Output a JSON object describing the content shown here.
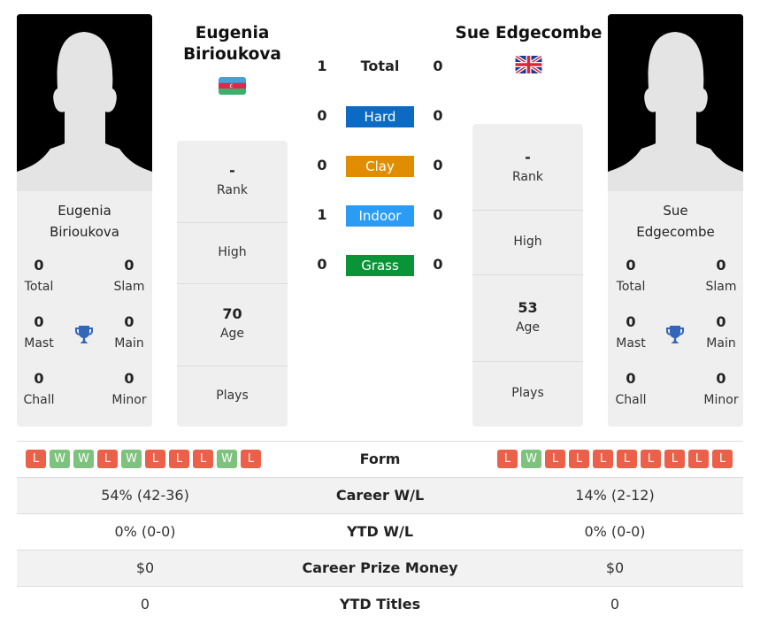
{
  "player1": {
    "name": "Eugenia Birioukova",
    "name_line1": "Eugenia",
    "name_line2": "Birioukova",
    "flag": "azerbaijan-flag",
    "titles": {
      "total": {
        "value": "0",
        "label": "Total"
      },
      "slam": {
        "value": "0",
        "label": "Slam"
      },
      "mast": {
        "value": "0",
        "label": "Mast"
      },
      "main": {
        "value": "0",
        "label": "Main"
      },
      "chall": {
        "value": "0",
        "label": "Chall"
      },
      "minor": {
        "value": "0",
        "label": "Minor"
      }
    },
    "info": {
      "rank": {
        "value": "-",
        "label": "Rank"
      },
      "high": {
        "value": "",
        "label": "High"
      },
      "age": {
        "value": "70",
        "label": "Age"
      },
      "plays": {
        "value": "",
        "label": "Plays"
      }
    },
    "form": [
      "L",
      "W",
      "W",
      "L",
      "W",
      "L",
      "L",
      "L",
      "W",
      "L"
    ],
    "career_wl": "54% (42-36)",
    "ytd_wl": "0% (0-0)",
    "prize_money": "$0",
    "ytd_titles": "0"
  },
  "player2": {
    "name": "Sue Edgecombe",
    "name_line1": "Sue",
    "name_line2": "Edgecombe",
    "flag": "united-kingdom-flag",
    "titles": {
      "total": {
        "value": "0",
        "label": "Total"
      },
      "slam": {
        "value": "0",
        "label": "Slam"
      },
      "mast": {
        "value": "0",
        "label": "Mast"
      },
      "main": {
        "value": "0",
        "label": "Main"
      },
      "chall": {
        "value": "0",
        "label": "Chall"
      },
      "minor": {
        "value": "0",
        "label": "Minor"
      }
    },
    "info": {
      "rank": {
        "value": "-",
        "label": "Rank"
      },
      "high": {
        "value": "",
        "label": "High"
      },
      "age": {
        "value": "53",
        "label": "Age"
      },
      "plays": {
        "value": "",
        "label": "Plays"
      }
    },
    "form": [
      "L",
      "W",
      "L",
      "L",
      "L",
      "L",
      "L",
      "L",
      "L",
      "L"
    ],
    "career_wl": "14% (2-12)",
    "ytd_wl": "0% (0-0)",
    "prize_money": "$0",
    "ytd_titles": "0"
  },
  "h2h": {
    "total": {
      "label": "Total",
      "p1": "1",
      "p2": "0"
    },
    "surfaces": [
      {
        "label": "Hard",
        "p1": "0",
        "p2": "0",
        "color": "#0b6bc4"
      },
      {
        "label": "Clay",
        "p1": "0",
        "p2": "0",
        "color": "#e08e00"
      },
      {
        "label": "Indoor",
        "p1": "1",
        "p2": "0",
        "color": "#2a9cf5"
      },
      {
        "label": "Grass",
        "p1": "0",
        "p2": "0",
        "color": "#0a9438"
      }
    ]
  },
  "table": {
    "form_label": "Form",
    "career_wl_label": "Career W/L",
    "ytd_wl_label": "YTD W/L",
    "prize_label": "Career Prize Money",
    "ytd_titles_label": "YTD Titles"
  },
  "colors": {
    "win": "#7dc27d",
    "loss": "#ec5f48",
    "trophy": "#3466b8"
  }
}
